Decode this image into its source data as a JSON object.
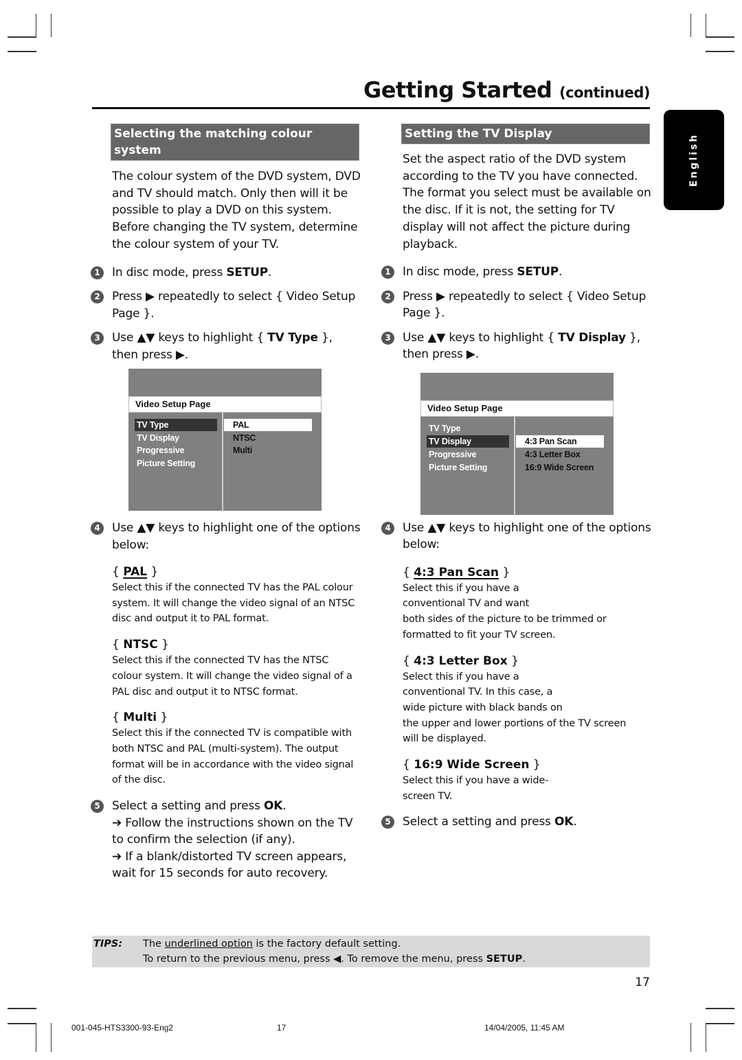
{
  "header": {
    "title": "Getting Started",
    "title_suffix": "(continued)"
  },
  "language_tab": "English",
  "left": {
    "section_title": "Selecting the matching colour system",
    "intro": "The colour system of the DVD system, DVD and TV should match. Only then will it be possible to play a DVD on this system.  Before changing the TV system, determine the colour system of your TV.",
    "steps": [
      {
        "num": "1",
        "pre": "In disc mode, press ",
        "bold": "SETUP",
        "post": "."
      },
      {
        "num": "2",
        "text": "Press ▶ repeatedly to select { Video Setup Page }."
      },
      {
        "num": "3",
        "pre": "Use ▲▼ keys to highlight { ",
        "bold": "TV Type",
        "post": " }, then press ▶."
      },
      {
        "num": "4",
        "text": "Use ▲▼ keys to highlight one of the options below:"
      },
      {
        "num": "5",
        "pre": "Select a setting and press ",
        "bold": "OK",
        "post": "."
      }
    ],
    "menu": {
      "title": "Video Setup Page",
      "left_items": [
        "TV Type",
        "TV Display",
        "Progressive",
        "Picture Setting"
      ],
      "selected_left": "TV Type",
      "right_items": [
        "PAL",
        "NTSC",
        "Multi"
      ],
      "selected_right": "PAL"
    },
    "options": [
      {
        "name": "PAL",
        "default": true,
        "desc": "Select this if the connected TV has the PAL colour system. It will change the video signal of an NTSC disc and output it to PAL format."
      },
      {
        "name": "NTSC",
        "default": false,
        "desc": "Select this if the connected TV has the NTSC colour system. It will change the video signal of a PAL disc and output it to NTSC format."
      },
      {
        "name": "Multi",
        "default": false,
        "desc": "Select this if the connected TV is compatible with both NTSC and PAL (multi-system). The output format will be in accordance with the video signal of the disc."
      }
    ],
    "step5_notes": [
      "➔ Follow the instructions shown on the TV to confirm the selection (if any).",
      "➔ If a blank/distorted TV screen appears, wait for 15 seconds for auto recovery."
    ]
  },
  "right": {
    "section_title": "Setting the TV Display",
    "intro": "Set the aspect ratio of the DVD system according to the TV you have connected. The format you select must be available on the disc.  If it is not, the setting for TV display will not affect the picture during playback.",
    "steps": [
      {
        "num": "1",
        "pre": "In disc mode, press ",
        "bold": "SETUP",
        "post": "."
      },
      {
        "num": "2",
        "text": "Press ▶ repeatedly to select { Video Setup Page }."
      },
      {
        "num": "3",
        "pre": "Use ▲▼ keys to highlight { ",
        "bold": "TV Display",
        "post": " }, then press ▶."
      },
      {
        "num": "4",
        "text": "Use ▲▼ keys to highlight one of the options below:"
      },
      {
        "num": "5",
        "pre": "Select a setting and press ",
        "bold": "OK",
        "post": "."
      }
    ],
    "menu": {
      "title": "Video Setup Page",
      "left_items": [
        "TV Type",
        "TV Display",
        "Progressive",
        "Picture Setting"
      ],
      "selected_left": "TV Display",
      "right_items": [
        "4:3 Pan Scan",
        "4:3 Letter Box",
        "16:9 Wide Screen"
      ],
      "selected_right": "4:3 Pan Scan"
    },
    "options": [
      {
        "name": "4:3 Pan Scan",
        "default": true,
        "desc_lines": [
          "Select this if you have a",
          "conventional TV and want",
          "both sides of the picture to be trimmed or",
          "formatted to fit your TV screen."
        ]
      },
      {
        "name": "4:3 Letter Box",
        "default": false,
        "desc_lines": [
          "Select this if you have a",
          "conventional TV.  In this case, a",
          "wide picture with black bands on",
          "the upper and lower portions of the TV screen",
          "will be displayed."
        ]
      },
      {
        "name": "16:9 Wide Screen",
        "default": false,
        "desc_lines": [
          "Select this if you have a wide-",
          "screen TV."
        ]
      }
    ]
  },
  "tips": {
    "label": "TIPS:",
    "line1_pre": "The ",
    "line1_underlined": "underlined option",
    "line1_post": " is the factory default setting.",
    "line2_pre": "To return to the previous menu, press ◀.  To remove the menu, press ",
    "line2_bold": "SETUP",
    "line2_post": "."
  },
  "page_number": "17",
  "footer": {
    "doc_id": "001-045-HTS3300-93-Eng2",
    "page": "17",
    "timestamp": "14/04/2005, 11:45 AM"
  }
}
